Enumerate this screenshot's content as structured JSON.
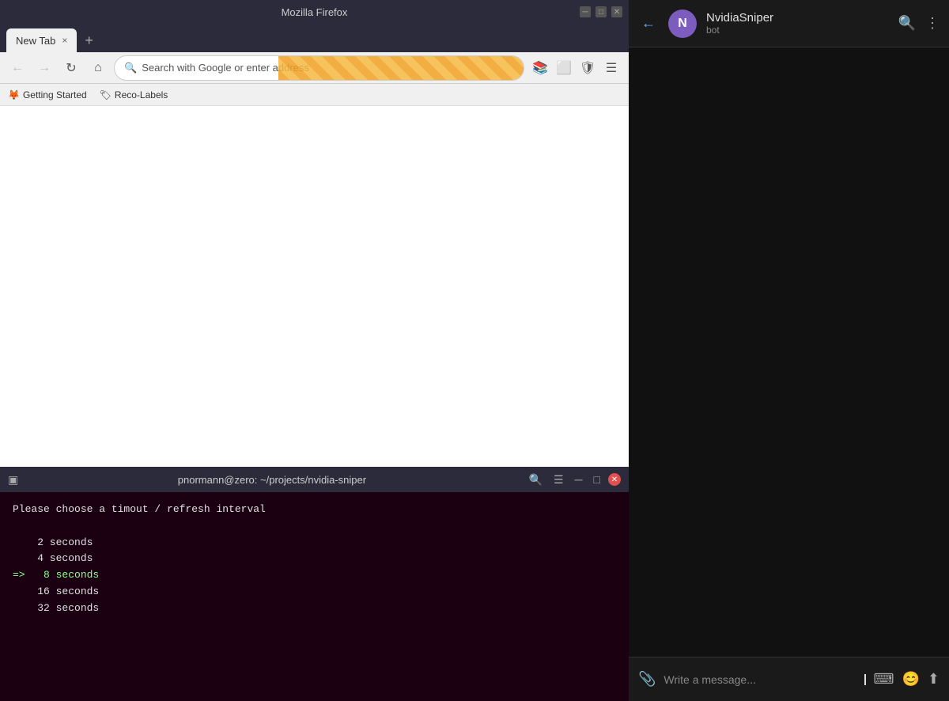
{
  "firefox": {
    "title": "Mozilla Firefox",
    "tab": {
      "label": "New Tab",
      "close": "×"
    },
    "new_tab_btn": "+",
    "nav": {
      "back": "←",
      "forward": "→",
      "refresh": "↻",
      "home": "⌂"
    },
    "address_bar": {
      "placeholder": "Search with Google or enter address",
      "icon": "🔍"
    },
    "toolbar_icons": {
      "library": "📚",
      "container": "⬜",
      "shield": "🛡",
      "menu": "☰"
    },
    "bookmarks": [
      {
        "label": "Getting Started",
        "icon": "🦊"
      },
      {
        "label": "Reco-Labels",
        "icon": "🏷"
      }
    ]
  },
  "terminal": {
    "title": "pnormann@zero: ~/projects/nvidia-sniper",
    "icon": "▣",
    "prompt_text": "Please choose a timout / refresh interval",
    "options": [
      {
        "value": "2 seconds",
        "selected": false
      },
      {
        "value": "4 seconds",
        "selected": false
      },
      {
        "value": "8 seconds",
        "selected": true
      },
      {
        "value": "16 seconds",
        "selected": false
      },
      {
        "value": "32 seconds",
        "selected": false
      }
    ],
    "arrow": "=>",
    "controls": {
      "search": "🔍",
      "menu": "☰",
      "minimize": "─",
      "maximize": "□",
      "close": "✕"
    }
  },
  "chat": {
    "header": {
      "back": "←",
      "avatar_letter": "N",
      "username": "NvidiaSniper",
      "status": "bot",
      "search_icon": "🔍",
      "more_icon": "⋮"
    },
    "input": {
      "placeholder": "Write a message...",
      "attachment_icon": "📎",
      "keyboard_icon": "⌨",
      "emoji_icon": "😊",
      "send_icon": "⬆"
    }
  }
}
